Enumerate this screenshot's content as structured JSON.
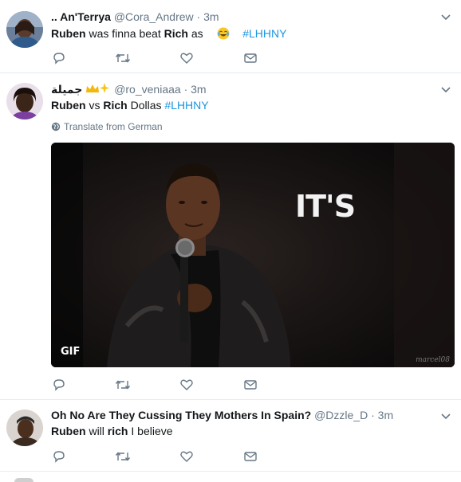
{
  "tweets": [
    {
      "name": ".. An'Terrya",
      "handle": "@Cora_Andrew",
      "separator": "·",
      "time": "3m",
      "text": {
        "bold1": "Ruben",
        "plain1": " was finna beat ",
        "bold2": "Rich",
        "plain2": " as",
        "emoji": "face-with-tears-of-joy",
        "hashtag": "#LHHNY"
      }
    },
    {
      "name": "جميلة",
      "name_emoji": "crown-sparkles",
      "handle": "@ro_veniaaa",
      "separator": "·",
      "time": "3m",
      "text": {
        "bold1": "Ruben",
        "plain1": " vs ",
        "bold2": "Rich",
        "plain2": " Dollas ",
        "hashtag": "#LHHNY"
      },
      "translate": "Translate from German",
      "media": {
        "overlay_text": "IT'S",
        "badge": "GIF",
        "watermark": "marcel08"
      }
    },
    {
      "name": "Oh No Are They Cussing They Mothers In Spain?",
      "handle": "@Dzzle_D",
      "separator": "·",
      "time": "3m",
      "text": {
        "bold1": "Ruben",
        "plain1": " will ",
        "bold2": "rich",
        "plain2": " I believe"
      }
    }
  ],
  "icons": {
    "reply": "reply-icon",
    "retweet": "retweet-icon",
    "like": "heart-icon",
    "dm": "envelope-icon",
    "more": "chevron-down-icon",
    "globe": "globe-icon"
  },
  "colors": {
    "link": "#1b95e0",
    "secondary": "#657786",
    "divider": "#e6ecf0",
    "icon": "#657786"
  }
}
